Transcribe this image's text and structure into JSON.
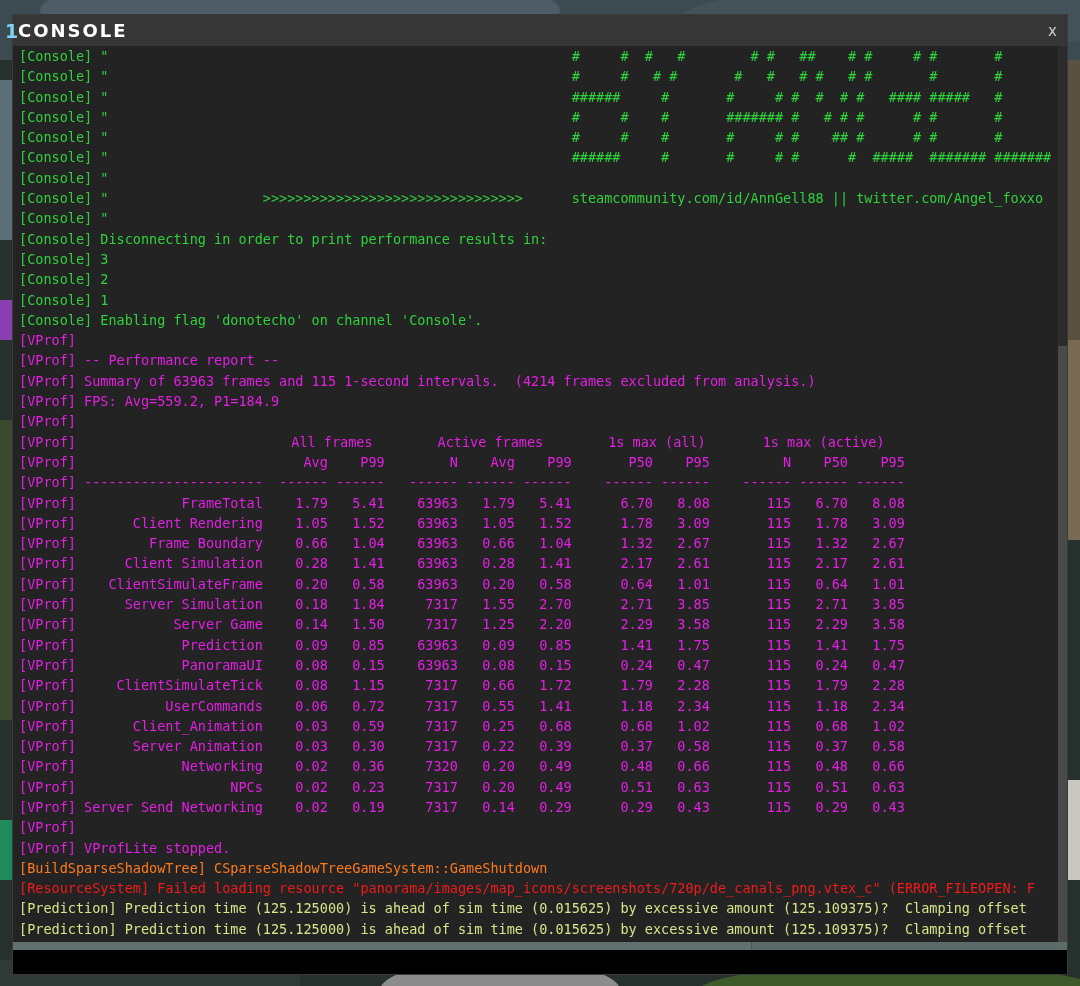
{
  "window": {
    "tab_number": "1",
    "title": "CONSOLE",
    "close": "x"
  },
  "log": [
    {
      "kind": "text",
      "color": "#2fd23c",
      "tag": "[Console]",
      "text": "\"                                                         #     #  #   #        # #   ##    # #     # #       #"
    },
    {
      "kind": "text",
      "color": "#2fd23c",
      "tag": "[Console]",
      "text": "\"                                                         #     #   # #       #   #   # #   # #       #       #"
    },
    {
      "kind": "text",
      "color": "#2fd23c",
      "tag": "[Console]",
      "text": "\"                                                         ######     #       #     # #  #  # #   #### #####   #"
    },
    {
      "kind": "text",
      "color": "#2fd23c",
      "tag": "[Console]",
      "text": "\"                                                         #     #    #       ####### #   # # #      # #       #"
    },
    {
      "kind": "text",
      "color": "#2fd23c",
      "tag": "[Console]",
      "text": "\"                                                         #     #    #       #     # #    ## #      # #       #"
    },
    {
      "kind": "text",
      "color": "#2fd23c",
      "tag": "[Console]",
      "text": "\"                                                         ######     #       #     # #      #  #####  ####### #######"
    },
    {
      "kind": "text",
      "color": "#2fd23c",
      "tag": "[Console]",
      "text": "\""
    },
    {
      "kind": "text",
      "color": "#2fd23c",
      "tag": "[Console]",
      "text": "\"                   >>>>>>>>>>>>>>>>>>>>>>>>>>>>>>>>      steamcommunity.com/id/AnnGell88 || twitter.com/Angel_foxxo"
    },
    {
      "kind": "text",
      "color": "#2fd23c",
      "tag": "[Console]",
      "text": "\""
    },
    {
      "kind": "text",
      "color": "#2fd23c",
      "tag": "[Console]",
      "text": "Disconnecting in order to print performance results in:"
    },
    {
      "kind": "text",
      "color": "#2fd23c",
      "tag": "[Console]",
      "text": "3"
    },
    {
      "kind": "text",
      "color": "#2fd23c",
      "tag": "[Console]",
      "text": "2"
    },
    {
      "kind": "text",
      "color": "#2fd23c",
      "tag": "[Console]",
      "text": "1"
    },
    {
      "kind": "text",
      "color": "#2fd23c",
      "tag": "[Console]",
      "text": "Enabling flag 'donotecho' on channel 'Console'."
    },
    {
      "kind": "text",
      "color": "#e41fe4",
      "tag": "[VProf]"
    },
    {
      "kind": "text",
      "color": "#e41fe4",
      "tag": "[VProf]",
      "text": "-- Performance report --"
    },
    {
      "kind": "text",
      "color": "#e41fe4",
      "tag": "[VProf]",
      "text": "Summary of 63963 frames and 115 1-second intervals.  (4214 frames excluded from analysis.)"
    },
    {
      "kind": "text",
      "color": "#e41fe4",
      "tag": "[VProf]",
      "text": "FPS: Avg=559.2, P1=184.9"
    },
    {
      "kind": "text",
      "color": "#e41fe4",
      "tag": "[VProf]"
    },
    {
      "kind": "table_groups",
      "color": "#e41fe4",
      "tag": "[VProf]",
      "groups": [
        "All frames",
        "Active frames",
        "1s max (all)",
        "1s max (active)"
      ]
    },
    {
      "kind": "table_header",
      "color": "#e41fe4",
      "tag": "[VProf]",
      "values": [
        "Avg",
        "P99",
        "N",
        "Avg",
        "P99",
        "P50",
        "P95",
        "N",
        "P50",
        "P95"
      ]
    },
    {
      "kind": "table_rule",
      "color": "#e41fe4",
      "tag": "[VProf]",
      "label": "----------------------",
      "values": [
        "------",
        "------",
        "------",
        "------",
        "------",
        "------",
        "------",
        "------",
        "------",
        "------"
      ]
    },
    {
      "kind": "table_row",
      "color": "#e41fe4",
      "tag": "[VProf]",
      "label": "FrameTotal",
      "values": [
        "1.79",
        "5.41",
        "63963",
        "1.79",
        "5.41",
        "6.70",
        "8.08",
        "115",
        "6.70",
        "8.08"
      ]
    },
    {
      "kind": "table_row",
      "color": "#e41fe4",
      "tag": "[VProf]",
      "label": "Client Rendering",
      "values": [
        "1.05",
        "1.52",
        "63963",
        "1.05",
        "1.52",
        "1.78",
        "3.09",
        "115",
        "1.78",
        "3.09"
      ]
    },
    {
      "kind": "table_row",
      "color": "#e41fe4",
      "tag": "[VProf]",
      "label": "Frame Boundary",
      "values": [
        "0.66",
        "1.04",
        "63963",
        "0.66",
        "1.04",
        "1.32",
        "2.67",
        "115",
        "1.32",
        "2.67"
      ]
    },
    {
      "kind": "table_row",
      "color": "#e41fe4",
      "tag": "[VProf]",
      "label": "Client Simulation",
      "values": [
        "0.28",
        "1.41",
        "63963",
        "0.28",
        "1.41",
        "2.17",
        "2.61",
        "115",
        "2.17",
        "2.61"
      ]
    },
    {
      "kind": "table_row",
      "color": "#e41fe4",
      "tag": "[VProf]",
      "label": "ClientSimulateFrame",
      "values": [
        "0.20",
        "0.58",
        "63963",
        "0.20",
        "0.58",
        "0.64",
        "1.01",
        "115",
        "0.64",
        "1.01"
      ]
    },
    {
      "kind": "table_row",
      "color": "#e41fe4",
      "tag": "[VProf]",
      "label": "Server Simulation",
      "values": [
        "0.18",
        "1.84",
        "7317",
        "1.55",
        "2.70",
        "2.71",
        "3.85",
        "115",
        "2.71",
        "3.85"
      ]
    },
    {
      "kind": "table_row",
      "color": "#e41fe4",
      "tag": "[VProf]",
      "label": "Server Game",
      "values": [
        "0.14",
        "1.50",
        "7317",
        "1.25",
        "2.20",
        "2.29",
        "3.58",
        "115",
        "2.29",
        "3.58"
      ]
    },
    {
      "kind": "table_row",
      "color": "#e41fe4",
      "tag": "[VProf]",
      "label": "Prediction",
      "values": [
        "0.09",
        "0.85",
        "63963",
        "0.09",
        "0.85",
        "1.41",
        "1.75",
        "115",
        "1.41",
        "1.75"
      ]
    },
    {
      "kind": "table_row",
      "color": "#e41fe4",
      "tag": "[VProf]",
      "label": "PanoramaUI",
      "values": [
        "0.08",
        "0.15",
        "63963",
        "0.08",
        "0.15",
        "0.24",
        "0.47",
        "115",
        "0.24",
        "0.47"
      ]
    },
    {
      "kind": "table_row",
      "color": "#e41fe4",
      "tag": "[VProf]",
      "label": "ClientSimulateTick",
      "values": [
        "0.08",
        "1.15",
        "7317",
        "0.66",
        "1.72",
        "1.79",
        "2.28",
        "115",
        "1.79",
        "2.28"
      ]
    },
    {
      "kind": "table_row",
      "color": "#e41fe4",
      "tag": "[VProf]",
      "label": "UserCommands",
      "values": [
        "0.06",
        "0.72",
        "7317",
        "0.55",
        "1.41",
        "1.18",
        "2.34",
        "115",
        "1.18",
        "2.34"
      ]
    },
    {
      "kind": "table_row",
      "color": "#e41fe4",
      "tag": "[VProf]",
      "label": "Client_Animation",
      "values": [
        "0.03",
        "0.59",
        "7317",
        "0.25",
        "0.68",
        "0.68",
        "1.02",
        "115",
        "0.68",
        "1.02"
      ]
    },
    {
      "kind": "table_row",
      "color": "#e41fe4",
      "tag": "[VProf]",
      "label": "Server Animation",
      "values": [
        "0.03",
        "0.30",
        "7317",
        "0.22",
        "0.39",
        "0.37",
        "0.58",
        "115",
        "0.37",
        "0.58"
      ]
    },
    {
      "kind": "table_row",
      "color": "#e41fe4",
      "tag": "[VProf]",
      "label": "Networking",
      "values": [
        "0.02",
        "0.36",
        "7320",
        "0.20",
        "0.49",
        "0.48",
        "0.66",
        "115",
        "0.48",
        "0.66"
      ]
    },
    {
      "kind": "table_row",
      "color": "#e41fe4",
      "tag": "[VProf]",
      "label": "NPCs",
      "values": [
        "0.02",
        "0.23",
        "7317",
        "0.20",
        "0.49",
        "0.51",
        "0.63",
        "115",
        "0.51",
        "0.63"
      ]
    },
    {
      "kind": "table_row",
      "color": "#e41fe4",
      "tag": "[VProf]",
      "label": "Server Send Networking",
      "values": [
        "0.02",
        "0.19",
        "7317",
        "0.14",
        "0.29",
        "0.29",
        "0.43",
        "115",
        "0.29",
        "0.43"
      ]
    },
    {
      "kind": "text",
      "color": "#e41fe4",
      "tag": "[VProf]"
    },
    {
      "kind": "text",
      "color": "#e41fe4",
      "tag": "[VProf]",
      "text": "VProfLite stopped."
    },
    {
      "kind": "text",
      "color": "#ff7a1c",
      "tag": "[BuildSparseShadowTree]",
      "text": "CSparseShadowTreeGameSystem::GameShutdown"
    },
    {
      "kind": "text",
      "color": "#f21a1a",
      "tag": "[ResourceSystem]",
      "text": "Failed loading resource \"panorama/images/map_icons/screenshots/720p/de_canals_png.vtex_c\" (ERROR_FILEOPEN: F"
    },
    {
      "kind": "text",
      "color": "#d5e68a",
      "tag": "[Prediction]",
      "text": "Prediction time (125.125000) is ahead of sim time (0.015625) by excessive amount (125.109375)?  Clamping offset"
    },
    {
      "kind": "text",
      "color": "#d5e68a",
      "tag": "[Prediction]",
      "text": "Prediction time (125.125000) is ahead of sim time (0.015625) by excessive amount (125.109375)?  Clamping offset"
    }
  ]
}
